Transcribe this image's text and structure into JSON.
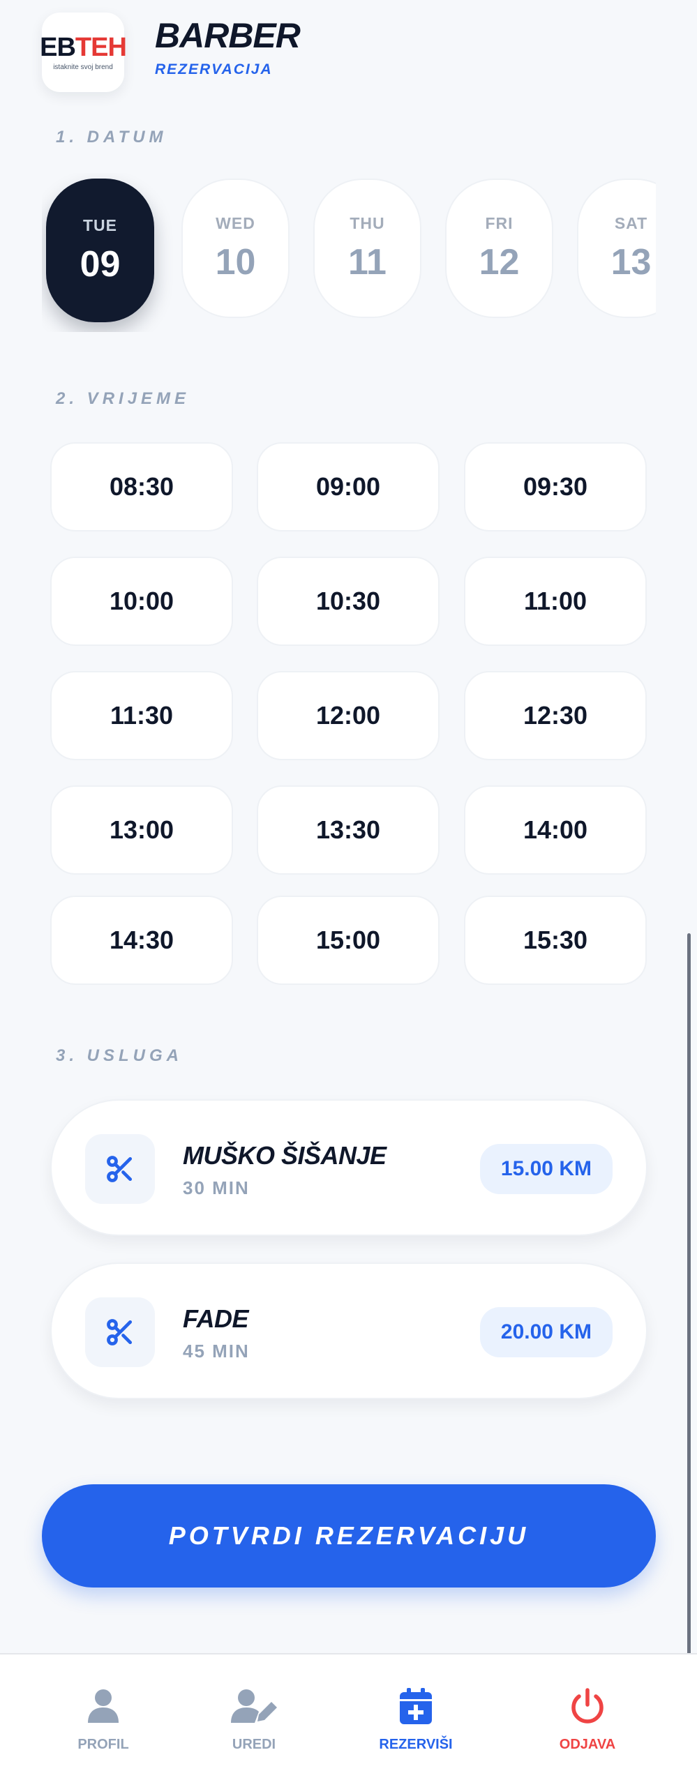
{
  "header": {
    "logo_eb": "EB",
    "logo_teh": "TEH",
    "logo_tagline": "istaknite svoj brend",
    "title": "BARBER",
    "subtitle": "REZERVACIJA"
  },
  "sections": {
    "date": "1. DATUM",
    "time": "2. VRIJEME",
    "service": "3. USLUGA"
  },
  "dates": [
    {
      "dow": "TUE",
      "day": "09",
      "selected": true
    },
    {
      "dow": "WED",
      "day": "10",
      "selected": false
    },
    {
      "dow": "THU",
      "day": "11",
      "selected": false
    },
    {
      "dow": "FRI",
      "day": "12",
      "selected": false
    },
    {
      "dow": "SAT",
      "day": "13",
      "selected": false
    }
  ],
  "times": [
    "08:30",
    "09:00",
    "09:30",
    "10:00",
    "10:30",
    "11:00",
    "11:30",
    "12:00",
    "12:30",
    "13:00",
    "13:30",
    "14:00",
    "14:30",
    "15:00",
    "15:30"
  ],
  "services": [
    {
      "name": "MUŠKO ŠIŠANJE",
      "duration": "30 MIN",
      "price": "15.00 KM",
      "icon": "scissors-icon"
    },
    {
      "name": "FADE",
      "duration": "45 MIN",
      "price": "20.00 KM",
      "icon": "scissors-icon"
    }
  ],
  "confirm_label": "POTVRDI REZERVACIJU",
  "nav": {
    "profil": "PROFIL",
    "uredi": "UREDI",
    "rezervisi": "REZERVIŠI",
    "odjava": "ODJAVA"
  },
  "colors": {
    "accent": "#2563eb",
    "dark": "#111a2e",
    "danger": "#ef4444",
    "muted": "#94a3b8",
    "background": "#f6f8fb"
  }
}
